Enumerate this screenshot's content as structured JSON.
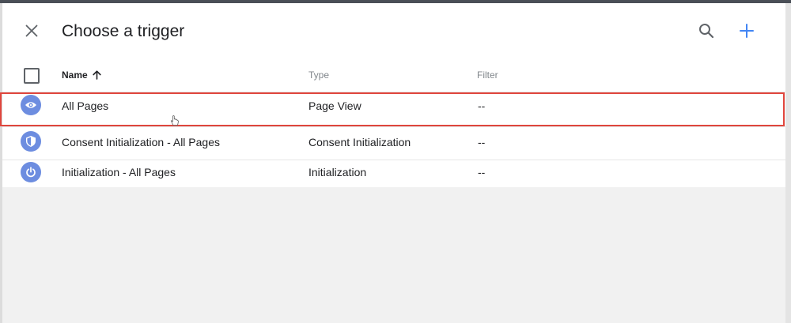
{
  "dialog": {
    "title": "Choose a trigger",
    "close_icon": "close-icon",
    "search_icon": "search-icon",
    "add_icon": "add-icon"
  },
  "table": {
    "columns": [
      {
        "label": "Name",
        "sort": "ascending",
        "sort_icon": "arrow-up-icon"
      },
      {
        "label": "Type"
      },
      {
        "label": "Filter"
      }
    ],
    "rows": [
      {
        "name": "All Pages",
        "type": "Page View",
        "filter": "--",
        "icon": "eye-icon",
        "highlighted": true
      },
      {
        "name": "Consent Initialization - All Pages",
        "type": "Consent Initialization",
        "filter": "--",
        "icon": "shield-icon"
      },
      {
        "name": "Initialization - All Pages",
        "type": "Initialization",
        "filter": "--",
        "icon": "power-icon"
      }
    ]
  },
  "colors": {
    "accent": "#4285f4",
    "trigger_icon": "#6d8de0",
    "highlight_border": "#e0463d",
    "backdrop": "#f1f1f1"
  }
}
